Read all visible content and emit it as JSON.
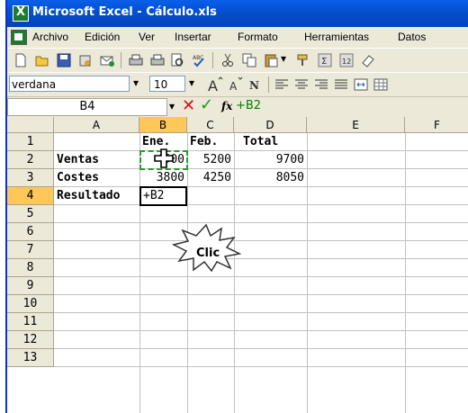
{
  "window": {
    "title": "Microsoft Excel - Cálculo.xls"
  },
  "menu": [
    "Archivo",
    "Edición",
    "Ver",
    "Insertar",
    "Formato",
    "Herramientas",
    "Datos"
  ],
  "format_toolbar": {
    "font": "verdana",
    "size": "10"
  },
  "formula_bar": {
    "name_box": "B4",
    "content": "+B2"
  },
  "sheet": {
    "columns": [
      "A",
      "B",
      "C",
      "D",
      "E",
      "F"
    ],
    "rows": [
      "1",
      "2",
      "3",
      "4",
      "5",
      "6",
      "7",
      "8",
      "9",
      "10",
      "11",
      "12",
      "13"
    ],
    "cells": {
      "B1": "Ene.",
      "C1": "Feb.",
      "D1": "Total",
      "A2": "Ventas",
      "B2": "4500",
      "C2": "5200",
      "D2": "9700",
      "A3": "Costes",
      "B3": "3800",
      "C3": "4250",
      "D3": "8050",
      "A4": "Resultado",
      "B4": "+B2"
    }
  },
  "callout": "Clic",
  "colors": {
    "selection_header": "#FFC65A",
    "marquee": "#2E9A2E",
    "titlebar": "#0550D0"
  }
}
